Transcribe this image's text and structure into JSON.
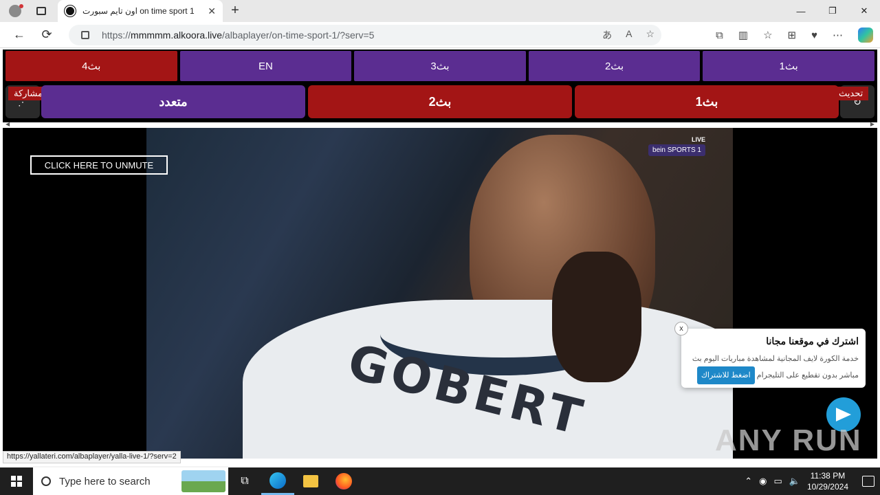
{
  "browser": {
    "tab_title": "اون تايم سبورت on time sport 1",
    "url_prefix": "https://",
    "url_domain": "mmmmm.alkoora.live",
    "url_path": "/albaplayer/on-time-sport-1/?serv=5",
    "new_tab": "+",
    "minimize": "—",
    "maximize": "❐",
    "close": "✕"
  },
  "servers_row1": [
    "بث4",
    "EN",
    "بث3",
    "بث2",
    "بث1"
  ],
  "servers_row2": {
    "multi": "متعدد",
    "bth2": "بث2",
    "bth1": "بث1",
    "share": "مشاركة",
    "refresh": "تحديث"
  },
  "video": {
    "unmute": "CLICK HERE TO UNMUTE",
    "live": "LIVE",
    "channel": "bein SPORTS 1",
    "jersey_name": "GOBERT"
  },
  "popup": {
    "title": "اشترك في موقعنا مجانا",
    "desc_line1": "خدمة الكورة لايف المجانية لمشاهدة مباريات اليوم بث",
    "desc_line2": "مباشر بدون تقطيع على التليجرام",
    "button": "اضغط للاشتراك",
    "close": "x"
  },
  "watermark": "ANY RUN",
  "status_url": "https://yallateri.com/albaplayer/yalla-live-1/?serv=2",
  "taskbar": {
    "search_placeholder": "Type here to search",
    "time": "11:38 PM",
    "date": "10/29/2024"
  }
}
